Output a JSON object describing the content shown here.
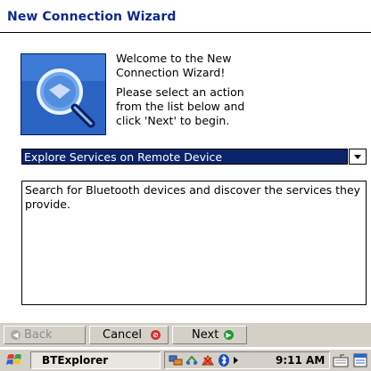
{
  "window": {
    "title": "New Connection Wizard"
  },
  "welcome": {
    "line1": "Welcome to the New Connection Wizard!",
    "line2": "Please select an action from the list below and click 'Next' to begin."
  },
  "action_select": {
    "selected": "Explore Services on Remote Device",
    "icon": "chevron-down-icon"
  },
  "description": {
    "text": "Search for Bluetooth devices and discover the services they provide."
  },
  "buttons": {
    "back": "Back",
    "cancel": "Cancel",
    "next": "Next"
  },
  "taskbar": {
    "active_app": "BTExplorer",
    "clock": "9:11 AM"
  },
  "colors": {
    "title": "#0d2a8c",
    "selection": "#0a246a",
    "chrome": "#d4d0c8",
    "cancel_icon": "#d92c2c",
    "next_icon": "#1f9a2d"
  }
}
